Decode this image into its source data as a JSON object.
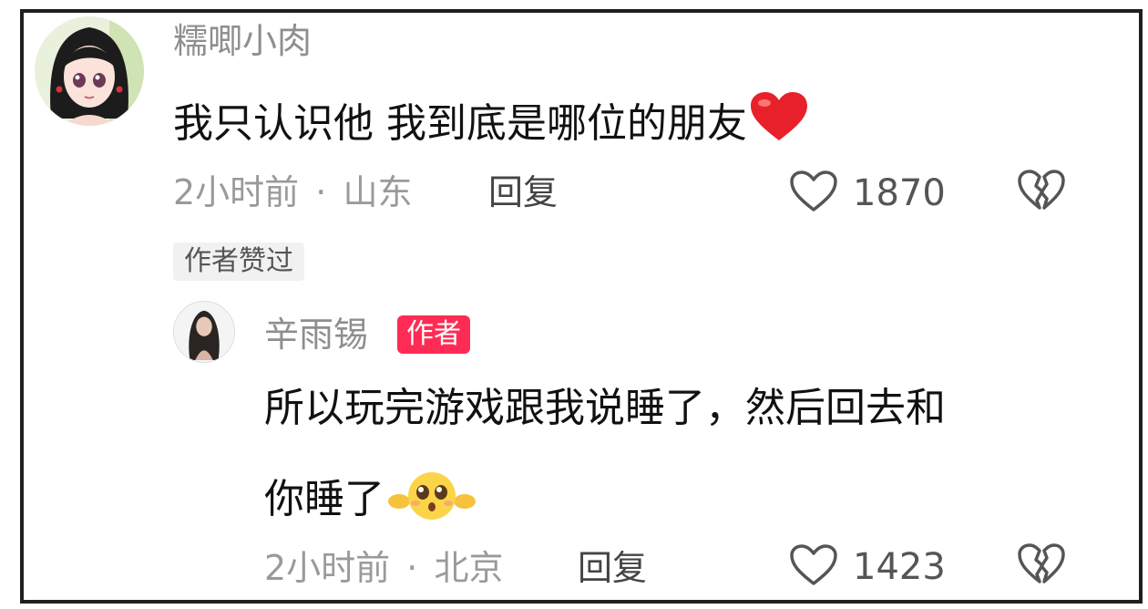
{
  "comment": {
    "username": "糯唧小肉",
    "text": "我只认识他 我到底是哪位的朋友",
    "text_emoji": "heart-emoji",
    "time": "2小时前",
    "location": "山东",
    "separator": "·",
    "reply_label": "回复",
    "like_count": "1870",
    "liked_by_author_tag": "作者赞过"
  },
  "reply": {
    "username": "辛雨锡",
    "author_badge": "作者",
    "text_line1": "所以玩完游戏跟我说睡了，然后回去和",
    "text_line2": "你睡了",
    "text_emoji": "pleading-face-emoji",
    "time": "2小时前",
    "location": "北京",
    "separator": "·",
    "reply_label": "回复",
    "like_count": "1423"
  },
  "icons": {
    "like": "heart-outline-icon",
    "dislike": "broken-heart-icon"
  },
  "colors": {
    "author_badge": "#fe2c55",
    "emoji_heart": "#e8202a",
    "meta_text": "#9a9a9a"
  }
}
